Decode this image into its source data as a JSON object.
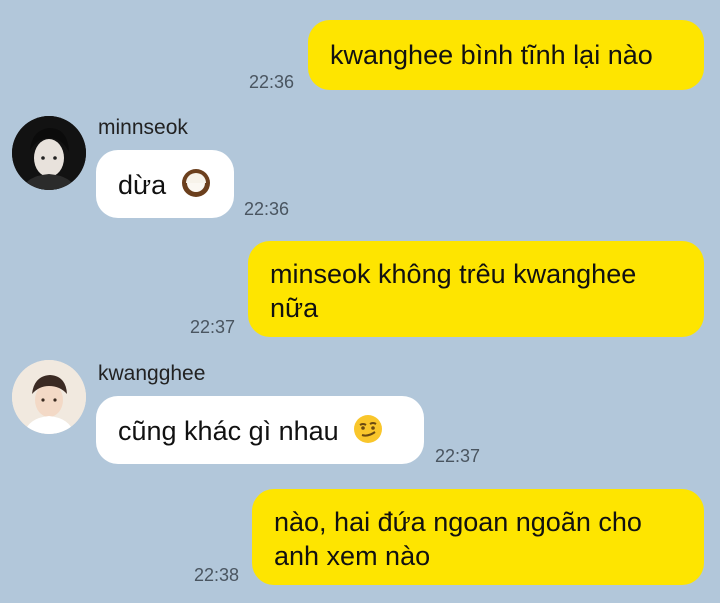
{
  "chat": {
    "messages": [
      {
        "sender": "me",
        "text": "kwanghee bình tĩnh lại nào",
        "time": "22:36"
      },
      {
        "sender": "minnseok",
        "text": "dừa",
        "time": "22:36",
        "emoji": "coconut-icon"
      },
      {
        "sender": "me",
        "text": "minseok không trêu kwanghee nữa",
        "time": "22:37"
      },
      {
        "sender": "kwangghee",
        "text": "cũng khác gì nhau",
        "time": "22:37",
        "emoji": "smirk-face-icon"
      },
      {
        "sender": "me",
        "text": "nào, hai đứa ngoan ngoãn cho anh xem nào",
        "time": "22:38"
      }
    ],
    "users": {
      "minnseok": {
        "name": "minnseok"
      },
      "kwangghee": {
        "name": "kwangghee"
      }
    }
  },
  "colors": {
    "background": "#b2c7da",
    "my_bubble": "#fee500",
    "their_bubble": "#ffffff"
  }
}
